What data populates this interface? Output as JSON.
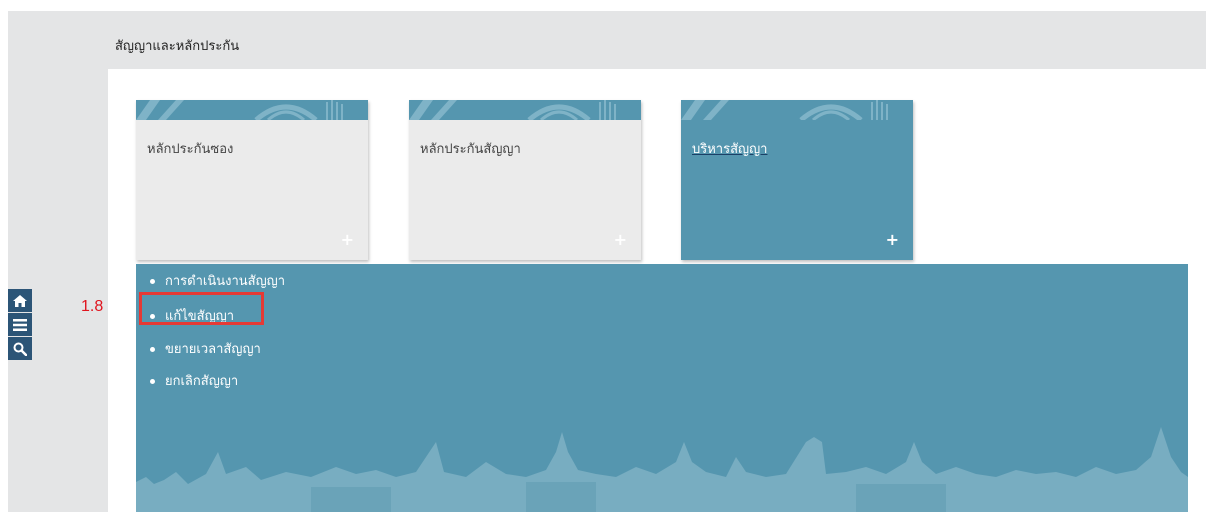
{
  "header": {
    "title": "สัญญาและหลักประกัน"
  },
  "cards": [
    {
      "title": "หลักประกันซอง",
      "plus": "+",
      "variant": "grey"
    },
    {
      "title": "หลักประกันสัญญา",
      "plus": "+",
      "variant": "grey"
    },
    {
      "title": "บริหารสัญญา",
      "plus": "+",
      "variant": "blue"
    }
  ],
  "submenu": {
    "items": [
      {
        "label": "การดำเนินงานสัญญา"
      },
      {
        "label": "แก้ไขสัญญา"
      },
      {
        "label": "ขยายเวลาสัญญา"
      },
      {
        "label": "ยกเลิกสัญญา"
      }
    ]
  },
  "side_icons": [
    "home-icon",
    "menu-icon",
    "search-icon"
  ],
  "annotation": {
    "step": "1.8",
    "highlighted_item": "แก้ไขสัญญา"
  },
  "colors": {
    "teal": "#5596af",
    "dark_blue": "#2c5577",
    "grey_panel": "#e4e5e6",
    "card_grey": "#ebebeb",
    "annotation_red": "#e53935"
  }
}
